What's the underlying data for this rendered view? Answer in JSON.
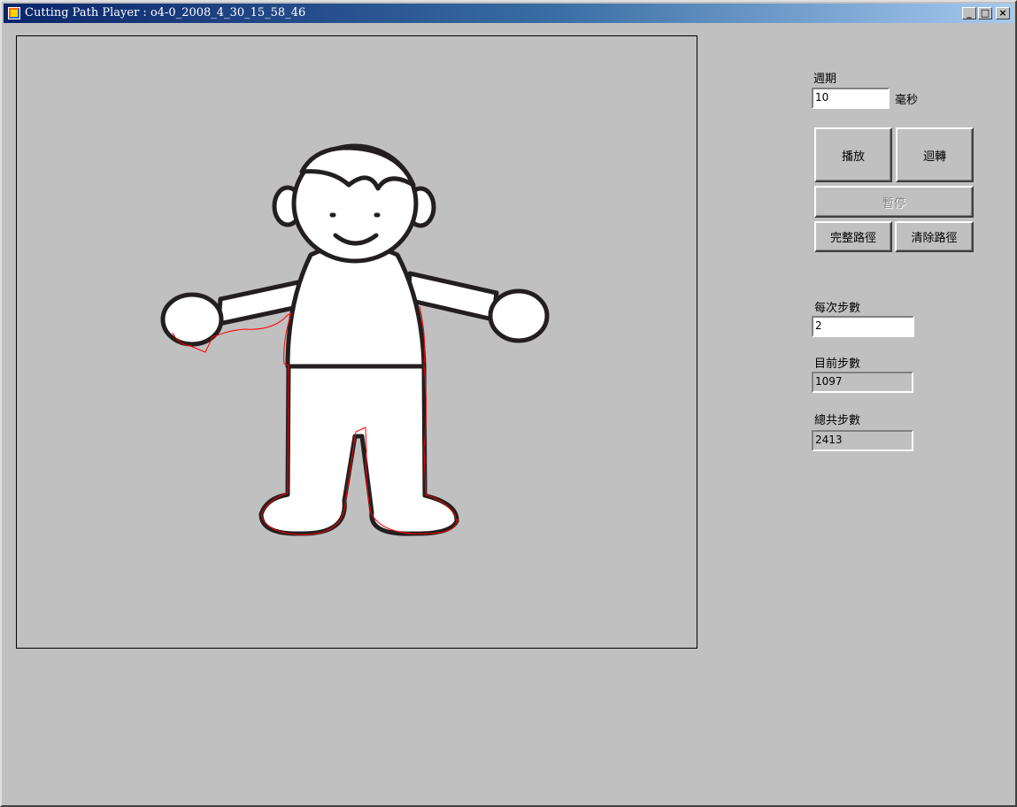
{
  "window": {
    "title": "Cutting Path Player : o4-0_2008_4_30_15_58_46",
    "controls": {
      "minimize": "_",
      "maximize": "□",
      "close": "×"
    }
  },
  "canvas": {
    "description_icon": "figure-drawing",
    "colors": {
      "background": "#c0c0c0",
      "outline": "#231f20",
      "fill": "#ffffff",
      "cut_path": "#ff0000"
    }
  },
  "settings": {
    "period_label": "週期",
    "period_value": "10",
    "period_unit": "毫秒",
    "play_label": "播放",
    "rewind_label": "迴轉",
    "pause_label": "暫停",
    "full_path_label": "完整路徑",
    "clear_path_label": "清除路徑",
    "steps_per_tick_label": "每次步數",
    "steps_per_tick_value": "2",
    "current_step_label": "目前步數",
    "current_step_value": "1097",
    "total_steps_label": "總共步數",
    "total_steps_value": "2413"
  }
}
